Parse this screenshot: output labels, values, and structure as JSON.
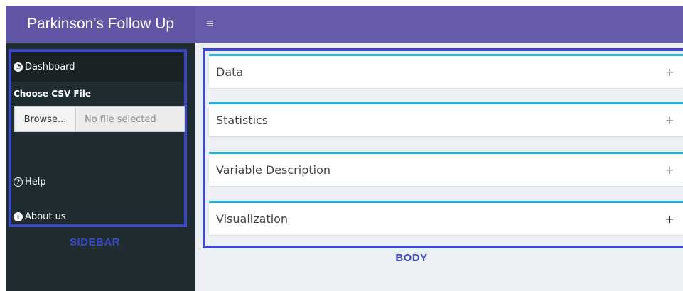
{
  "header": {
    "title": "Parkinson's Follow Up",
    "menu_icon": "hamburger-icon",
    "menu_glyph": "≡",
    "logo_color": "#6155a6",
    "bar_color": "#675cab"
  },
  "sidebar": {
    "dashboard": {
      "label": "Dashboard",
      "icon": "dashboard-icon",
      "glyph": "◔"
    },
    "csv_label": "Choose CSV File",
    "browse_label": "Browse...",
    "file_placeholder": "No file selected",
    "help": {
      "label": "Help",
      "icon": "question-circle-icon",
      "glyph": "?"
    },
    "about": {
      "label": "About us",
      "icon": "info-circle-icon",
      "glyph": "i"
    },
    "annotation": "SIDEBAR",
    "bg_color": "#1f2d33"
  },
  "body": {
    "boxes": [
      {
        "title": "Data",
        "tool": "+"
      },
      {
        "title": "Statistics",
        "tool": "+"
      },
      {
        "title": "Variable Description",
        "tool": "+"
      },
      {
        "title": "Visualization",
        "tool": "+"
      }
    ],
    "annotation": "BODY",
    "box_border_color": "#25b3d8",
    "annotation_color": "#3d48c4"
  }
}
